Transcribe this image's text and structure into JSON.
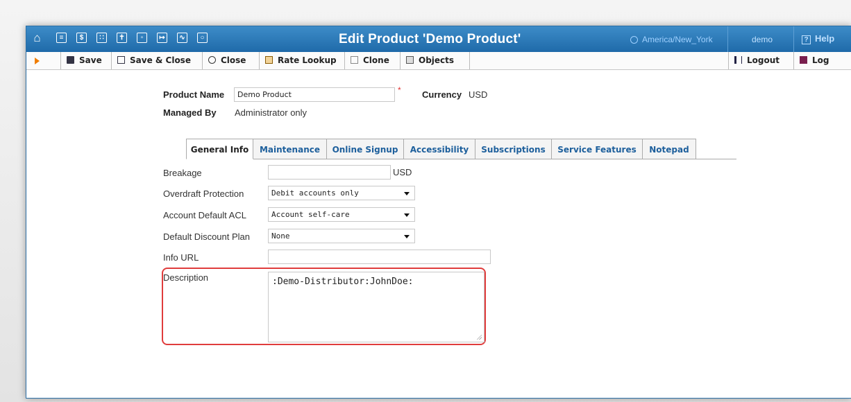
{
  "titlebar": {
    "title": "Edit Product 'Demo Product'",
    "timezone": "America/New_York",
    "user": "demo",
    "help": "Help",
    "nav_icons": [
      "home-icon",
      "list-icon",
      "dollar-icon",
      "grid-icon",
      "person-icon",
      "network-icon",
      "export-icon",
      "chart-icon",
      "search-icon"
    ]
  },
  "toolbar": {
    "save": "Save",
    "save_close": "Save & Close",
    "close": "Close",
    "rate_lookup": "Rate Lookup",
    "clone": "Clone",
    "objects": "Objects",
    "logout": "Logout",
    "log": "Log"
  },
  "header": {
    "product_name_label": "Product Name",
    "product_name_value": "Demo Product",
    "currency_label": "Currency",
    "currency_value": "USD",
    "managed_by_label": "Managed By",
    "managed_by_value": "Administrator only"
  },
  "tabs": [
    {
      "label": "General Info",
      "active": true
    },
    {
      "label": "Maintenance"
    },
    {
      "label": "Online Signup"
    },
    {
      "label": "Accessibility"
    },
    {
      "label": "Subscriptions"
    },
    {
      "label": "Service Features"
    },
    {
      "label": "Notepad"
    }
  ],
  "form": {
    "breakage_label": "Breakage",
    "breakage_value": "",
    "breakage_unit": "USD",
    "overdraft_label": "Overdraft Protection",
    "overdraft_value": "Debit accounts only",
    "acl_label": "Account Default ACL",
    "acl_value": "Account self-care",
    "discount_label": "Default Discount Plan",
    "discount_value": "None",
    "info_url_label": "Info URL",
    "info_url_value": "",
    "description_label": "Description",
    "description_value": ":Demo-Distributor:JohnDoe:"
  },
  "colors": {
    "titlebar": "#1f6aa9",
    "tab_text": "#1d5f9c",
    "highlight": "#e03c3c",
    "play_accent": "#f07d00"
  }
}
